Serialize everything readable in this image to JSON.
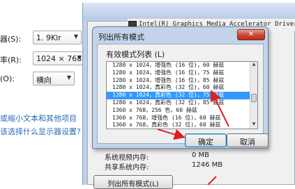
{
  "left_panel": {
    "resolution_label": "器(S):",
    "resolution_value": "1. 9Klr",
    "rate_label": "率(R):",
    "rate_value": "1024 × 768",
    "orientation_label": "(O):",
    "orientation_value": "横向",
    "link_text_size": "或缩小文本和其他项目",
    "link_display_settings": "该选择什么显示器设置?"
  },
  "adapter_window": {
    "title": "Intel(R) Graphics Media Accelerator Driver",
    "system_video_memory_label": "系统视频内存:",
    "system_video_memory_value": "0 MB",
    "shared_system_memory_label": "共享系统内存:",
    "shared_system_memory_value": "1246 MB",
    "list_all_modes_button": "列出所有模式(L)"
  },
  "dialog": {
    "title": "列出所有模式",
    "close_label": "✕",
    "group_label": "有效模式列表 (L)",
    "modes": [
      "1280 x 1024，增强色 (16 位)，60 赫兹",
      "1280 x 1024，增强色 (16 位)，75 赫兹",
      "1280 x 1024，增强色 (16 位)，85 赫兹",
      "1280 x 1024，真彩色 (32 位)，60 赫兹",
      "1280 x 1024，真彩色 (32 位)，75 赫兹",
      "1280 x 1024，真彩色 (32 位)，85 赫兹",
      "1360 x 768，256 色，60 赫兹",
      "1360 x 768，增强色 (16 位)，60 赫兹",
      "1360 x 768，真彩色 (32 位)，60 赫兹"
    ],
    "selected_index": 4,
    "ok_button": "确定",
    "cancel_button": "取消"
  },
  "colors": {
    "selection": "#3399ff",
    "annotation_arrow": "#e02020",
    "link": "#2a6ab5"
  }
}
